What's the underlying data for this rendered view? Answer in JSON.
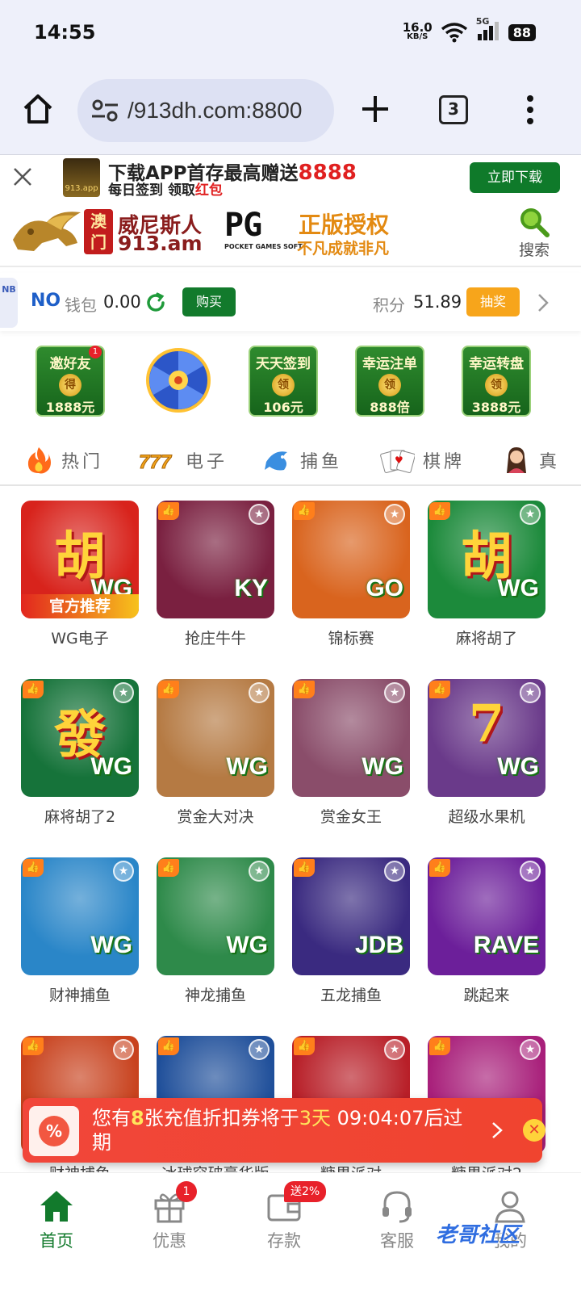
{
  "status_bar": {
    "time": "14:55",
    "net_speed_value": "16.0",
    "net_speed_unit": "KB/S",
    "network": "5G",
    "battery": "88"
  },
  "browser": {
    "url": "/913dh.com:8800",
    "tab_count": "3"
  },
  "promo": {
    "headline": "下载APP首存最高赠送",
    "headline_amount": "8888",
    "subline": "每日签到 领取",
    "subline_highlight": "红包",
    "logo_text": "913.app",
    "button": "立即下载"
  },
  "site_header": {
    "macau_seal": "澳门",
    "brand_name": "威尼斯人",
    "brand_domain": "913.am",
    "pg_logo": "PG",
    "pg_sub": "POCKET GAMES SOFT",
    "pg_title": "正版授权",
    "pg_tagline": "不凡成就非凡",
    "search_label": "搜索"
  },
  "wallet": {
    "side_tab": "NB",
    "no_logo": "NO",
    "wallet_label": "钱包",
    "wallet_value": "0.00",
    "buy_button": "购买",
    "points_label": "积分",
    "points_value": "51.89",
    "draw_button": "抽奖"
  },
  "activities": [
    {
      "title": "邀好友",
      "coin": "得",
      "amount": "1888元",
      "badge": "1"
    },
    {
      "title": "",
      "coin": "",
      "amount": "",
      "badge": ""
    },
    {
      "title": "天天签到",
      "coin": "领",
      "amount": "106元",
      "badge": ""
    },
    {
      "title": "幸运注单",
      "coin": "领",
      "amount": "888倍",
      "badge": ""
    },
    {
      "title": "幸运转盘",
      "coin": "领",
      "amount": "3888元",
      "badge": ""
    }
  ],
  "categories": [
    {
      "label": "热门",
      "icon": "flame-icon"
    },
    {
      "label": "电子",
      "icon": "slot-777-icon"
    },
    {
      "label": "捕鱼",
      "icon": "fish-icon"
    },
    {
      "label": "棋牌",
      "icon": "cards-icon"
    },
    {
      "label": "真",
      "icon": "live-dealer-icon"
    }
  ],
  "games": [
    {
      "name": "WG电子",
      "bg": "#d8231c",
      "glyph": "胡",
      "tag": "WG",
      "ribbon": "官方推荐"
    },
    {
      "name": "抢庄牛牛",
      "bg": "#7a2040",
      "glyph": "",
      "tag": "KY",
      "ribbon": ""
    },
    {
      "name": "锦标赛",
      "bg": "#d9641e",
      "glyph": "",
      "tag": "GO",
      "ribbon": ""
    },
    {
      "name": "麻将胡了",
      "bg": "#1c8a3b",
      "glyph": "胡",
      "tag": "WG",
      "ribbon": ""
    },
    {
      "name": "麻将胡了2",
      "bg": "#16733a",
      "glyph": "發",
      "tag": "WG",
      "ribbon": ""
    },
    {
      "name": "赏金大对决",
      "bg": "#b57a43",
      "glyph": "",
      "tag": "WG",
      "ribbon": ""
    },
    {
      "name": "赏金女王",
      "bg": "#8a4d6a",
      "glyph": "",
      "tag": "WG",
      "ribbon": ""
    },
    {
      "name": "超级水果机",
      "bg": "#6a3a8a",
      "glyph": "7",
      "tag": "WG",
      "ribbon": ""
    },
    {
      "name": "财神捕鱼",
      "bg": "#2a86c8",
      "glyph": "",
      "tag": "WG",
      "ribbon": ""
    },
    {
      "name": "神龙捕鱼",
      "bg": "#2e8a4a",
      "glyph": "",
      "tag": "WG",
      "ribbon": ""
    },
    {
      "name": "五龙捕鱼",
      "bg": "#3a2a80",
      "glyph": "",
      "tag": "JDB",
      "ribbon": ""
    },
    {
      "name": "跳起来",
      "bg": "#6c1f9a",
      "glyph": "",
      "tag": "RAVE",
      "ribbon": ""
    },
    {
      "name": "财神捕鱼",
      "bg": "#c8421e",
      "glyph": "",
      "tag": "",
      "ribbon": ""
    },
    {
      "name": "冰球突破豪华版",
      "bg": "#1f4f9a",
      "glyph": "",
      "tag": "",
      "ribbon": ""
    },
    {
      "name": "糖果派对",
      "bg": "#b81f28",
      "glyph": "",
      "tag": "",
      "ribbon": ""
    },
    {
      "name": "糖果派对2",
      "bg": "#a81f7a",
      "glyph": "",
      "tag": "",
      "ribbon": ""
    }
  ],
  "coupon": {
    "prefix": "您有",
    "count": "8",
    "middle": "张充值折扣券将于",
    "days": "3天",
    "time": " 09:04:07",
    "suffix": "后过期"
  },
  "bottom_nav": [
    {
      "label": "首页",
      "icon": "home-icon",
      "badge": "",
      "active": true
    },
    {
      "label": "优惠",
      "icon": "gift-icon",
      "badge": "1",
      "active": false
    },
    {
      "label": "存款",
      "icon": "wallet-icon",
      "badge": "送2%",
      "active": false
    },
    {
      "label": "客服",
      "icon": "headset-icon",
      "badge": "",
      "active": false
    },
    {
      "label": "我的",
      "icon": "user-icon",
      "badge": "",
      "active": false
    }
  ],
  "watermark": "老哥社区",
  "colors": {
    "brand_green": "#127a2c",
    "accent_orange": "#f7a51b",
    "alert_red": "#f1463a"
  }
}
